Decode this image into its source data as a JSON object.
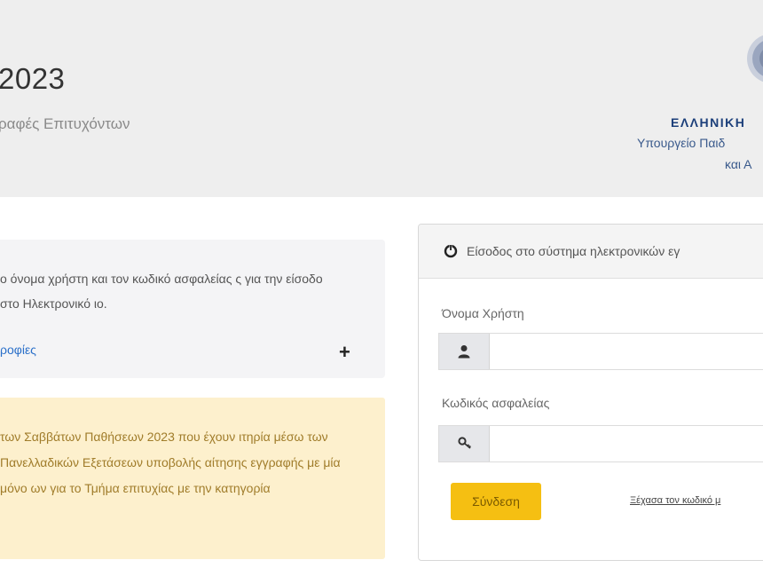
{
  "header": {
    "title": "2023",
    "subtitle": "ραφές Επιτυχόντων",
    "ministry": {
      "line1": "ΕΛΛΗΝΙΚΗ",
      "line2": "Υπουργείο Παιδ",
      "line3": "και Α"
    }
  },
  "info_panel": {
    "text": "ο όνομα χρήστη και τον κωδικό ασφαλείας ς για την είσοδο στο Ηλεκτρονικό ιο.",
    "link": "ροφίες",
    "expand_icon": "plus-icon"
  },
  "notice": {
    "text": "των Σαββάτων Παθήσεων 2023 που έχουν ιτηρία μέσω των Πανελλαδικών Εξετάσεων υποβολής αίτησης εγγραφής με μία μόνο ων για το Τμήμα επιτυχίας με την κατηγορία"
  },
  "login": {
    "header": "Είσοδος στο σύστημα ηλεκτρονικών εγ",
    "header_icon": "power-icon",
    "username_label": "Όνομα Χρήστη",
    "username_icon": "user-icon",
    "username_value": "",
    "password_label": "Κωδικός ασφαλείας",
    "password_icon": "key-icon",
    "password_value": "",
    "submit_label": "Σύνδεση",
    "forgot_label": "Ξέχασα τον κωδικό μ"
  }
}
